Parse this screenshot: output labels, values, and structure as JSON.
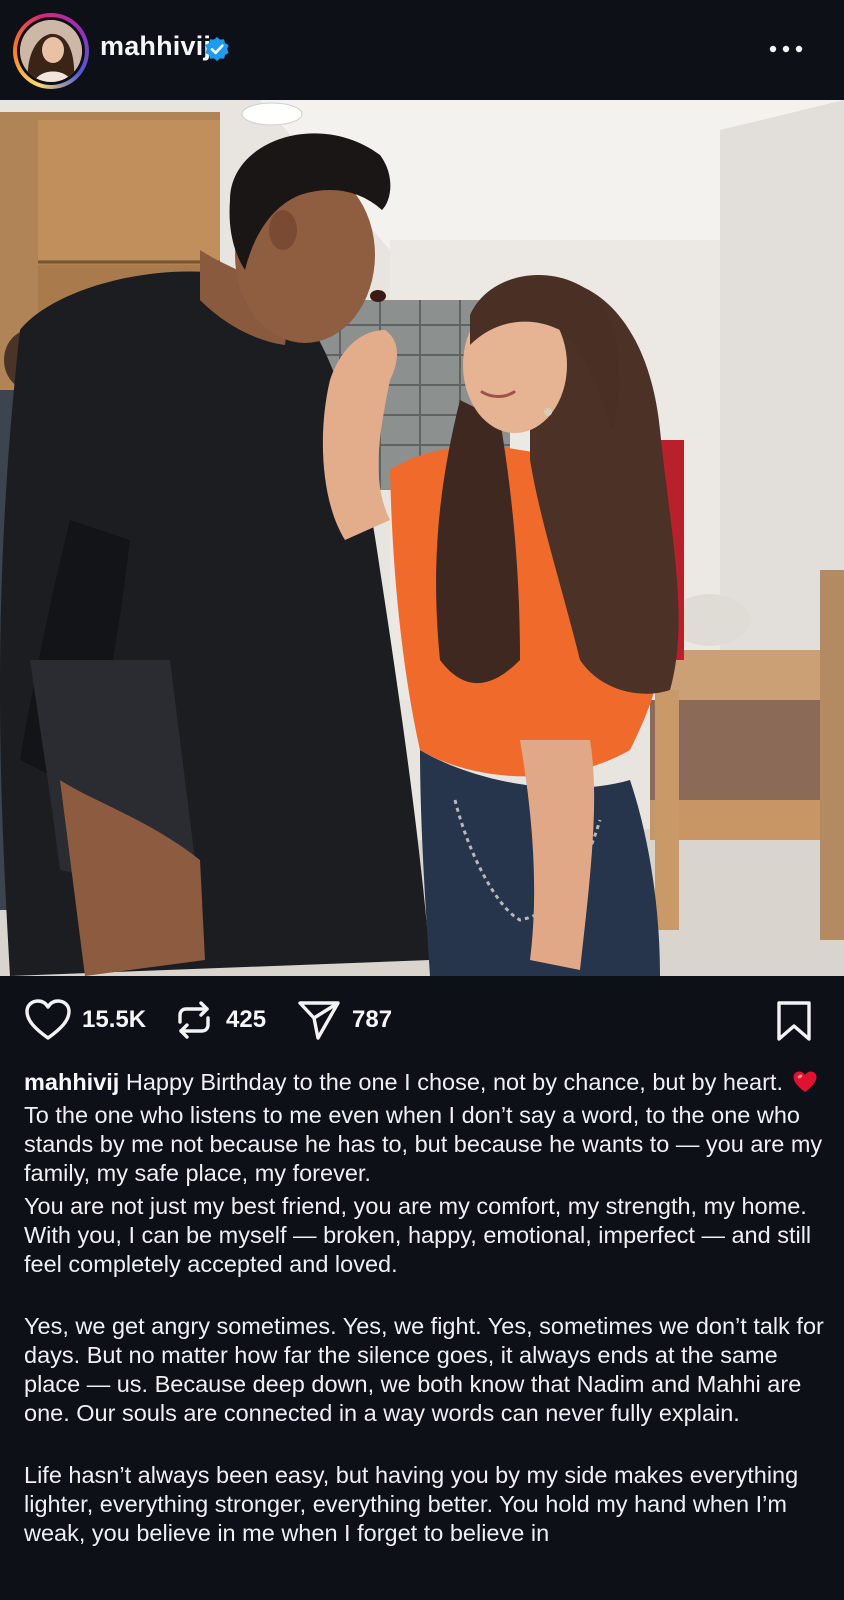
{
  "post": {
    "username": "mahhivij",
    "verified": true,
    "more_icon": "more-horizontal-icon"
  },
  "actions": {
    "likes": "15.5K",
    "reposts": "425",
    "shares": "787"
  },
  "caption": {
    "username": "mahhivij",
    "first_line": "Happy Birthday to the one I chose, not by chance, but by heart.",
    "emoji": "red-heart",
    "paragraphs": [
      "To the one who listens to me even when I don’t say a word, to the one who stands by me not because he has to, but because he wants to — you are my family, my safe place, my forever.",
      "You are not just my best friend, you are my comfort, my strength, my home. With you, I can be myself — broken, happy, emotional, imperfect — and still feel completely accepted and loved.",
      "Yes, we get angry sometimes. Yes, we fight. Yes, sometimes we don’t talk for days. But no matter how far the silence goes, it always ends at the same place — us. Because deep down, we both know that Nadim and Mahhi are one. Our souls are connected in a way words can never fully explain.",
      "Life hasn’t always been easy, but having you by my side makes everything lighter, everything stronger, everything better. You hold my hand when I’m weak, you believe in me when I forget to believe in"
    ]
  },
  "colors": {
    "background": "#0d1017",
    "text": "#f2f3f5",
    "verified_badge": "#1d9bf0",
    "heart": "#e0122f"
  }
}
